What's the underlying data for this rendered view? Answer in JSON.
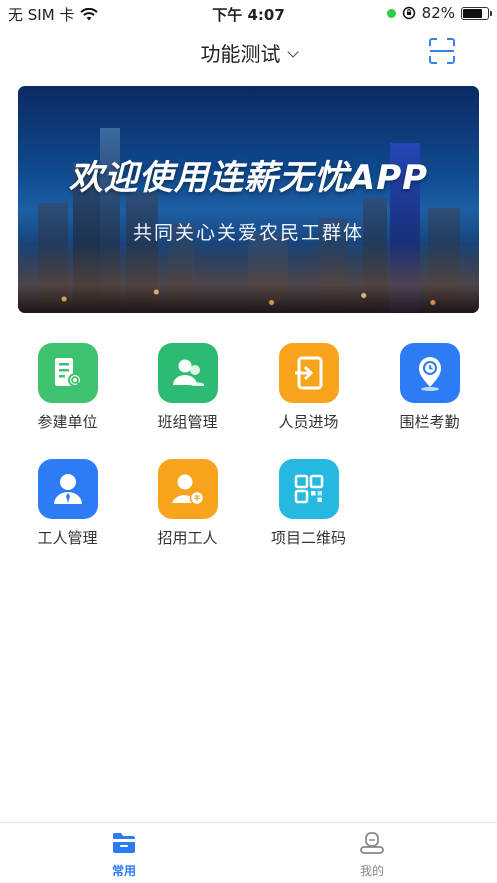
{
  "status_bar": {
    "carrier": "无 SIM 卡",
    "time": "下午 4:07",
    "battery": "82%",
    "battery_level": 0.82
  },
  "header": {
    "title": "功能测试",
    "scan_icon": "scan-icon"
  },
  "banner": {
    "title": "欢迎使用连薪无忧APP",
    "subtitle": "共同关心关爱农民工群体"
  },
  "functions": [
    {
      "label": "参建单位",
      "icon": "building-search-icon",
      "color": "#3fc270"
    },
    {
      "label": "班组管理",
      "icon": "team-icon",
      "color": "#2dbb73"
    },
    {
      "label": "人员进场",
      "icon": "entry-door-icon",
      "color": "#f7a41c"
    },
    {
      "label": "围栏考勤",
      "icon": "location-pin-icon",
      "color": "#2b7cf5"
    },
    {
      "label": "工人管理",
      "icon": "worker-icon",
      "color": "#2b7cf5"
    },
    {
      "label": "招用工人",
      "icon": "recruit-worker-icon",
      "color": "#f7a41c"
    },
    {
      "label": "项目二维码",
      "icon": "qr-code-icon",
      "color": "#25b8e0"
    }
  ],
  "tabbar": {
    "tabs": [
      {
        "label": "常用",
        "icon": "folder-icon",
        "active": true,
        "color": "#2b7cf5"
      },
      {
        "label": "我的",
        "icon": "user-icon",
        "active": false,
        "color": "#888888"
      }
    ]
  }
}
